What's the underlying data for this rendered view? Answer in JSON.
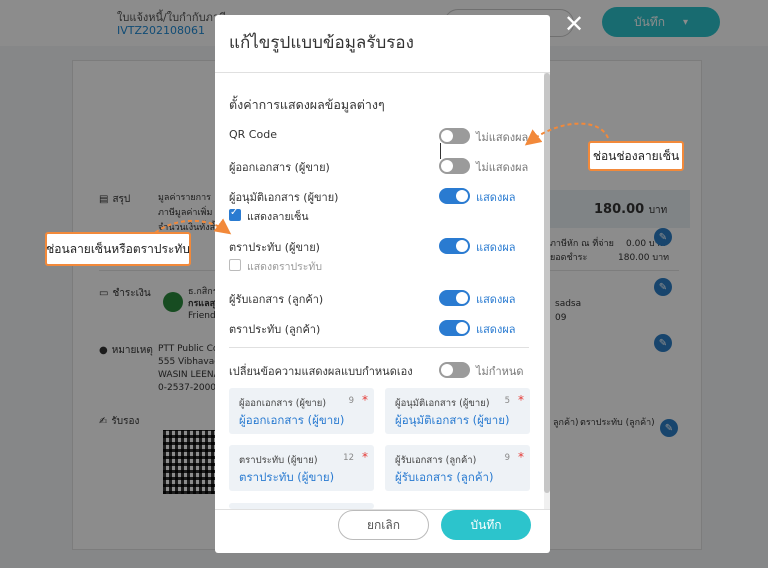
{
  "background": {
    "doc_type": "ใบแจ้งหนี้/ใบกำกับภาษี",
    "doc_number": "IVTZ202108061",
    "save_label": "บันทึก",
    "summary_label": "สรุป",
    "summary_text": [
      "มูลค่ารายการ",
      "ภาษีมูลค่าเพิ่ม",
      "จำนวนเงินทั้งสิ้น"
    ],
    "total_value": "180.00",
    "total_unit": "บาท",
    "tax_label": "ภาษีหัก ณ ที่จ่าย",
    "tax_value": "0.00 บาท",
    "pay_label": "ยอดชำระ",
    "pay_value": "180.00 บาท",
    "payment_label": "ชำระเงิน",
    "bank_lines": [
      "ธ.กสิกร",
      "กรแลสุ",
      "Friend"
    ],
    "payer_text": "sadsa",
    "payer_date": "09",
    "note_label": "หมายเหตุ",
    "note_lines": [
      "PTT Public Co",
      "555 Vibhavadi",
      "WASIN LEENA",
      "0-2537-2000"
    ],
    "sign_label": "รับรอง",
    "sign_right_a": "ลูกค้า)",
    "sign_right_b": "ตราประทับ (ลูกค้า)"
  },
  "modal": {
    "title": "แก้ไขรูปแบบข้อมูลรับรอง",
    "section_title": "ตั้งค่าการแสดงผลข้อมูลต่างๆ",
    "rows": [
      {
        "label": "QR Code",
        "state": "off",
        "status": "ไม่แสดงผล"
      },
      {
        "label": "ผู้ออกเอกสาร (ผู้ขาย)",
        "state": "off",
        "status": "ไม่แสดงผล"
      },
      {
        "label": "ผู้อนุมัติเอกสาร (ผู้ขาย)",
        "state": "on",
        "status": "แสดงผล"
      },
      {
        "label": "ตราประทับ (ผู้ขาย)",
        "state": "on",
        "status": "แสดงผล"
      },
      {
        "label": "ผู้รับเอกสาร (ลูกค้า)",
        "state": "on",
        "status": "แสดงผล"
      },
      {
        "label": "ตราประทับ (ลูกค้า)",
        "state": "on",
        "status": "แสดงผล"
      }
    ],
    "checkboxes": [
      {
        "label": "แสดงลายเซ็น",
        "checked": true
      },
      {
        "label": "แสดงตราประทับ",
        "checked": false
      }
    ],
    "custom_toggle": {
      "label": "เปลี่ยนข้อความแสดงผลแบบกำหนดเอง",
      "state": "off",
      "status": "ไม่กำหนด"
    },
    "fields": [
      {
        "label": "ผู้ออกเอกสาร (ผู้ขาย)",
        "count": "9",
        "value": "ผู้ออกเอกสาร (ผู้ขาย)"
      },
      {
        "label": "ผู้อนุมัติเอกสาร (ผู้ขาย)",
        "count": "5",
        "value": "ผู้อนุมัติเอกสาร (ผู้ขาย)"
      },
      {
        "label": "ตราประทับ (ผู้ขาย)",
        "count": "12",
        "value": "ตราประทับ (ผู้ขาย)"
      },
      {
        "label": "ผู้รับเอกสาร (ลูกค้า)",
        "count": "9",
        "value": "ผู้รับเอกสาร (ลูกค้า)"
      }
    ],
    "required_mark": "*",
    "cancel_label": "ยกเลิก",
    "save_label": "บันทึก"
  },
  "close_glyph": "✕",
  "callouts": {
    "signature_slot": "ช่อนช่องลายเซ็น",
    "signature_or_stamp": "ช่อนลายเซ็นหรือตราประทับ"
  },
  "colors": {
    "accent": "#2a7bd1",
    "primary_button": "#2cc4cc",
    "toggle_off": "#9b9b9b",
    "callout_border": "#f2893a",
    "required": "#e53935"
  }
}
